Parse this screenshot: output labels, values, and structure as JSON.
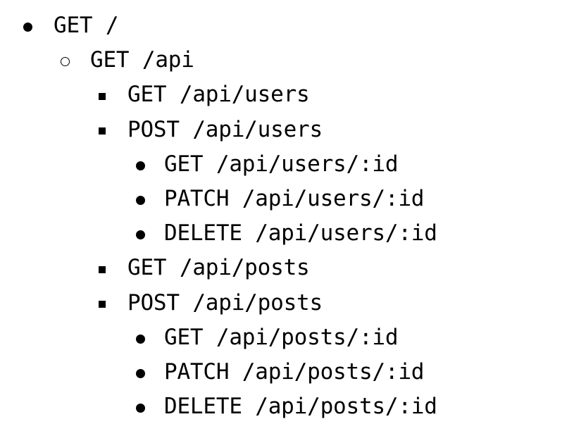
{
  "list": {
    "items": [
      {
        "label": "GET /",
        "level": 0,
        "marker": "disc"
      },
      {
        "label": "GET /api",
        "level": 1,
        "marker": "circle"
      },
      {
        "label": "GET /api/users",
        "level": 2,
        "marker": "square"
      },
      {
        "label": "POST /api/users",
        "level": 2,
        "marker": "square"
      },
      {
        "label": "GET /api/users/:id",
        "level": 3,
        "marker": "disc"
      },
      {
        "label": "PATCH /api/users/:id",
        "level": 3,
        "marker": "disc"
      },
      {
        "label": "DELETE /api/users/:id",
        "level": 3,
        "marker": "disc"
      },
      {
        "label": "GET /api/posts",
        "level": 2,
        "marker": "square"
      },
      {
        "label": "POST /api/posts",
        "level": 2,
        "marker": "square"
      },
      {
        "label": "GET /api/posts/:id",
        "level": 3,
        "marker": "disc"
      },
      {
        "label": "PATCH /api/posts/:id",
        "level": 3,
        "marker": "disc"
      },
      {
        "label": "DELETE /api/posts/:id",
        "level": 3,
        "marker": "disc"
      }
    ]
  }
}
